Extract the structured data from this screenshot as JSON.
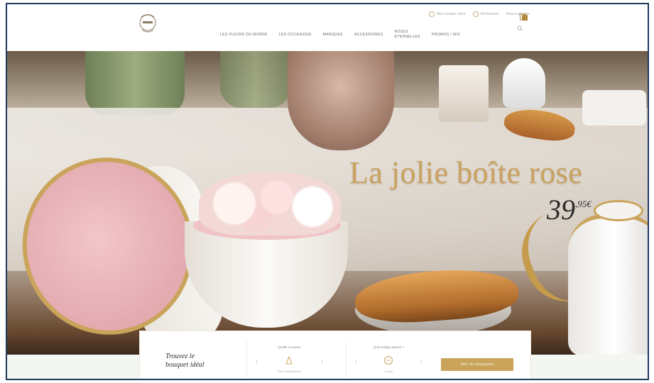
{
  "header": {
    "utility_links": [
      "Mon compte client",
      "Rechercher",
      "Nous contacter"
    ],
    "nav": [
      "Les Fleurs du Monde",
      "Les Occasions",
      "Marques",
      "Accessoires",
      "Roses\nÉternelles",
      "Promos / Mix"
    ]
  },
  "hero": {
    "title": "La jolie boîte rose",
    "price": "39",
    "price_cents": ",95€"
  },
  "finder": {
    "title": "Trouvez le\nbouquet idéal",
    "occasion_label": "Quelle occasion",
    "occasion_value": "Fête / Anniversaire",
    "budget_label": "Quel budget prévoir ?",
    "budget_value": "Aucun",
    "cta_label": "Voir les bouquets"
  },
  "colors": {
    "accent_gold": "#c9a45a",
    "frame_border": "#1e3a5f"
  },
  "icons": {
    "search": "search-icon",
    "cart": "cart-icon",
    "account": "user-icon"
  }
}
